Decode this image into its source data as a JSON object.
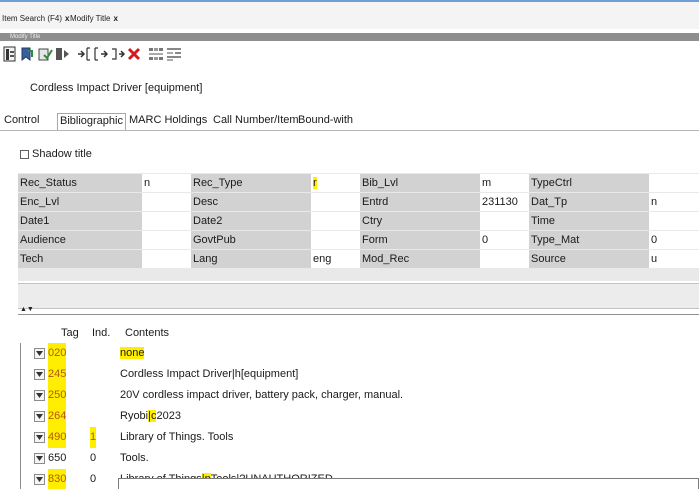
{
  "doc_tabs": [
    {
      "label": "Item Search (F4)",
      "close": "x"
    },
    {
      "label": "Modify Title",
      "close": "x"
    }
  ],
  "panel_title": "Modify Title",
  "toolbar": {
    "icons": [
      "save-record-icon",
      "bookmark-icon",
      "validate-icon",
      "split-icon",
      "indent-in-icon",
      "indent-out-icon",
      "delete-icon",
      "expand-grid-icon",
      "collapse-grid-icon"
    ]
  },
  "record": {
    "title": "Cordless Impact Driver [equipment]"
  },
  "tabs": [
    "Control",
    "Bibliographic",
    "MARC Holdings",
    "Call Number/Item",
    "Bound-with"
  ],
  "active_tab": "Bibliographic",
  "shadow_title": {
    "label": "Shadow title",
    "checked": false
  },
  "fixed_fields": [
    [
      {
        "label": "Rec_Status",
        "value": "n"
      },
      {
        "label": "Rec_Type",
        "value": "r",
        "highlight": true
      },
      {
        "label": "Bib_Lvl",
        "value": "m"
      },
      {
        "label": "TypeCtrl",
        "value": ""
      }
    ],
    [
      {
        "label": "Enc_Lvl",
        "value": ""
      },
      {
        "label": "Desc",
        "value": ""
      },
      {
        "label": "Entrd",
        "value": "231130"
      },
      {
        "label": "Dat_Tp",
        "value": "n"
      }
    ],
    [
      {
        "label": "Date1",
        "value": ""
      },
      {
        "label": "Date2",
        "value": ""
      },
      {
        "label": "Ctry",
        "value": ""
      },
      {
        "label": "Time",
        "value": ""
      }
    ],
    [
      {
        "label": "Audience",
        "value": ""
      },
      {
        "label": "GovtPub",
        "value": ""
      },
      {
        "label": "Form",
        "value": "0"
      },
      {
        "label": "Type_Mat",
        "value": "0"
      }
    ],
    [
      {
        "label": "Tech",
        "value": ""
      },
      {
        "label": "Lang",
        "value": "eng"
      },
      {
        "label": "Mod_Rec",
        "value": ""
      },
      {
        "label": "Source",
        "value": "u"
      }
    ]
  ],
  "marc_table": {
    "headers": {
      "tag": "Tag",
      "ind": "Ind.",
      "contents": "Contents"
    },
    "sort_glyph": "▲▼",
    "rows": [
      {
        "tag": "020",
        "tag_hl": true,
        "ind": "",
        "ind_hl": false,
        "segments": [
          {
            "text": "none",
            "hl": true
          }
        ]
      },
      {
        "tag": "245",
        "tag_hl": true,
        "ind": "",
        "ind_hl": false,
        "segments": [
          {
            "text": "Cordless Impact Driver|h[equipment]",
            "hl": false
          }
        ]
      },
      {
        "tag": "250",
        "tag_hl": true,
        "ind": "",
        "ind_hl": false,
        "segments": [
          {
            "text": "20V cordless impact driver, battery pack, charger, manual.",
            "hl": false
          }
        ]
      },
      {
        "tag": "264",
        "tag_hl": true,
        "ind": "",
        "ind_hl": false,
        "segments": [
          {
            "text": "Ryobi",
            "hl": false
          },
          {
            "text": "|c",
            "hl": true
          },
          {
            "text": "2023",
            "hl": false
          }
        ]
      },
      {
        "tag": "490",
        "tag_hl": true,
        "ind": "1",
        "ind_hl": true,
        "segments": [
          {
            "text": "Library of Things. Tools",
            "hl": false
          }
        ]
      },
      {
        "tag": "650",
        "tag_hl": false,
        "ind": "0",
        "ind_hl": false,
        "segments": [
          {
            "text": "Tools.",
            "hl": false
          }
        ]
      },
      {
        "tag": "830",
        "tag_hl": true,
        "ind": "0",
        "ind_hl": false,
        "segments": [
          {
            "text": "Library of Things",
            "hl": false
          },
          {
            "text": "|p",
            "hl": true
          },
          {
            "text": "Tools|?UNAUTHORIZED",
            "hl": false
          }
        ]
      }
    ]
  },
  "colors": {
    "highlight": "#ffee00",
    "tag_color": "#b35a00",
    "delete_icon": "#d21c1c",
    "accent_line": "#6f9fd8"
  }
}
